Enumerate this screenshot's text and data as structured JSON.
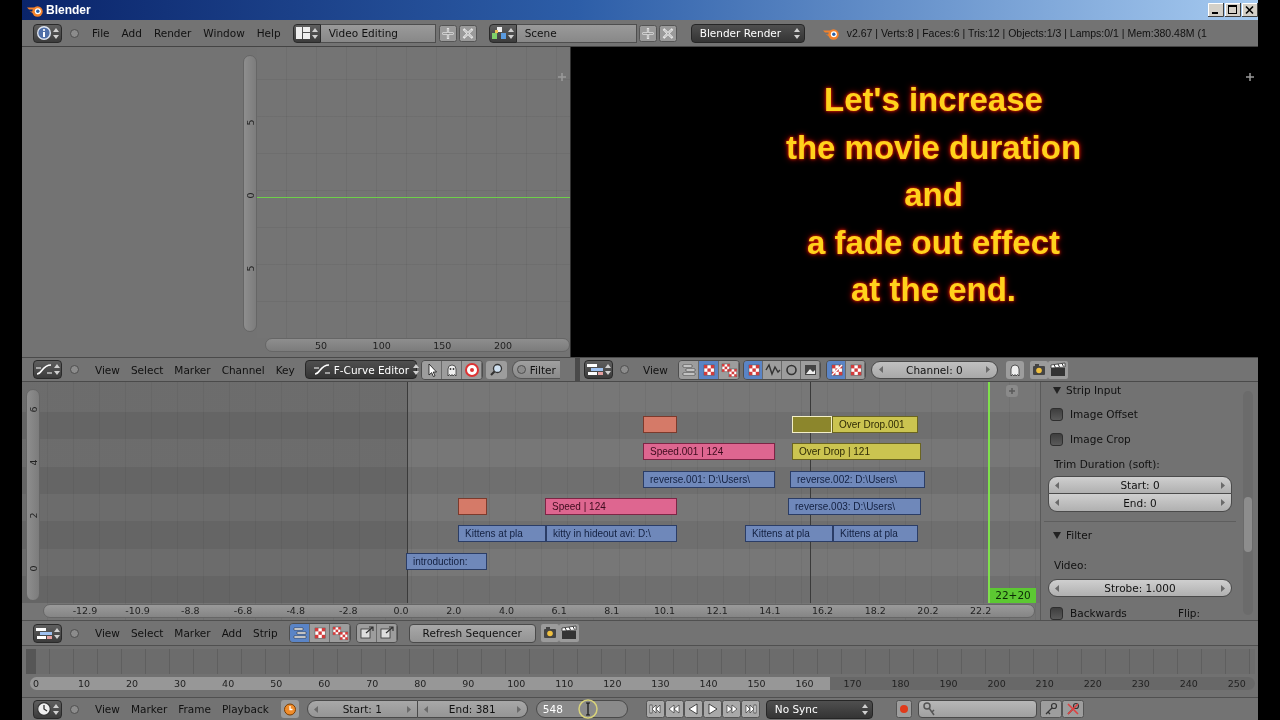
{
  "window": {
    "title": "Blender"
  },
  "info_header": {
    "menus": [
      "File",
      "Add",
      "Render",
      "Window",
      "Help"
    ],
    "screen_layout": "Video Editing",
    "scene": "Scene",
    "render_engine": "Blender Render",
    "stats": "v2.67 | Verts:8 | Faces:6 | Tris:12 | Objects:1/3 | Lamps:0/1 | Mem:380.48M (1"
  },
  "graph_editor": {
    "y_labels": [
      "5",
      "0",
      "5"
    ],
    "x_labels": [
      "50",
      "100",
      "150",
      "200"
    ]
  },
  "preview": {
    "caption": [
      "Let's increase",
      "the movie duration",
      "and",
      "a fade out effect",
      "at the end."
    ]
  },
  "graph_header": {
    "menus": [
      "View",
      "Select",
      "Marker",
      "Channel",
      "Key"
    ],
    "mode": "F-Curve Editor",
    "filter": "Filter"
  },
  "preview_header": {
    "menus": [
      "View"
    ],
    "view_toggles": [
      {
        "selected": false
      },
      {
        "selected": true
      },
      {
        "selected": false
      }
    ],
    "display_toggles": [
      {
        "selected": true
      },
      {
        "selected": false
      },
      {
        "selected": false
      },
      {
        "selected": false
      }
    ],
    "overlay_toggles": [
      {
        "selected": true
      },
      {
        "selected": false
      }
    ],
    "channel": "Channel: 0"
  },
  "sequencer": {
    "channel_labels": [
      "6",
      "4",
      "2",
      "0"
    ],
    "channels": [
      {
        "strips": [
          {
            "kind": "effect",
            "selected": false
          },
          {
            "kind": "color",
            "selected": true
          },
          {
            "kind": "overdrop",
            "label": "Over Drop.001",
            "selected": false
          }
        ]
      },
      {
        "strips": [
          {
            "kind": "speed",
            "label": "Speed.001 | 124",
            "selected": false
          },
          {
            "kind": "overdrop",
            "label": "Over Drop | 121",
            "selected": false
          }
        ]
      },
      {
        "strips": [
          {
            "kind": "movie",
            "label": "reverse.001: D:\\Users\\",
            "selected": false
          },
          {
            "kind": "movie",
            "label": "reverse.002: D:\\Users\\",
            "selected": false
          }
        ]
      },
      {
        "strips": [
          {
            "kind": "effect",
            "selected": false
          },
          {
            "kind": "speed",
            "label": "Speed | 124",
            "selected": false
          },
          {
            "kind": "movie",
            "label": "reverse.003: D:\\Users\\",
            "selected": false
          }
        ]
      },
      {
        "strips": [
          {
            "kind": "movie",
            "label": "Kittens at pla",
            "selected": false
          },
          {
            "kind": "movie",
            "label": "kitty in hideout avi: D:\\",
            "selected": false
          },
          {
            "kind": "movie",
            "label": "Kittens at pla",
            "selected": false
          },
          {
            "kind": "movie",
            "label": "Kittens at pla",
            "selected": false
          }
        ]
      },
      {
        "strips": [
          {
            "kind": "movie",
            "label": "introduction:",
            "selected": false
          }
        ]
      }
    ],
    "current_frame": "22+20",
    "ruler": [
      "-12.9",
      "-10.9",
      "-8.8",
      "-6.8",
      "-4.8",
      "-2.8",
      "0.0",
      "2.0",
      "4.0",
      "6.1",
      "8.1",
      "10.1",
      "12.1",
      "14.1",
      "16.2",
      "18.2",
      "20.2",
      "22.2"
    ]
  },
  "strip_panel": {
    "input_section": {
      "title": "Strip Input",
      "expanded": true
    },
    "checkboxes": [
      {
        "label": "Image Offset",
        "checked": false
      },
      {
        "label": "Image Crop",
        "checked": false
      }
    ],
    "trim_label": "Trim Duration (soft):",
    "trim_fields": [
      "Start: 0",
      "End: 0"
    ],
    "filter_section": {
      "title": "Filter",
      "expanded": true
    },
    "video_label": "Video:",
    "strobe": "Strobe: 1.000",
    "backwards": {
      "label": "Backwards",
      "checked": false
    },
    "flip_label": "Flip:"
  },
  "sequencer_header": {
    "menus": [
      "View",
      "Select",
      "Marker",
      "Add",
      "Strip"
    ],
    "view_toggles": [
      {
        "selected": true
      },
      {
        "selected": false
      },
      {
        "selected": false
      }
    ],
    "refresh_button": "Refresh Sequencer"
  },
  "timeline": {
    "ruler": [
      "0",
      "10",
      "20",
      "30",
      "40",
      "50",
      "60",
      "70",
      "80",
      "90",
      "100",
      "110",
      "120",
      "130",
      "140",
      "150",
      "160",
      "170",
      "180",
      "190",
      "200",
      "210",
      "220",
      "230",
      "240",
      "250"
    ]
  },
  "timeline_header": {
    "menus": [
      "View",
      "Marker",
      "Frame",
      "Playback"
    ],
    "start": "Start: 1",
    "end": "End: 381",
    "current_frame": "548",
    "sync": "No Sync"
  }
}
